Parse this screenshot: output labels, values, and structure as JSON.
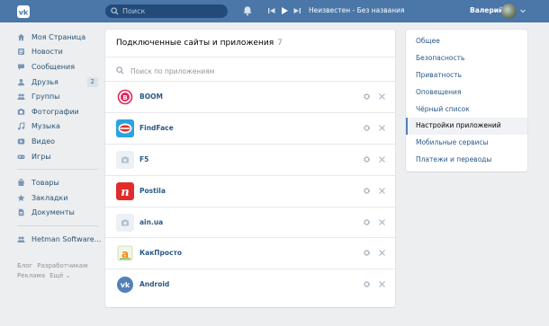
{
  "header": {
    "search_placeholder": "Поиск",
    "player_track": "Неизвестен - Без названия",
    "user_name": "Валерий",
    "brand_color": "#4a76a8"
  },
  "sidebar": {
    "items": [
      {
        "label": "Моя Страница",
        "icon": "home-icon"
      },
      {
        "label": "Новости",
        "icon": "news-icon"
      },
      {
        "label": "Сообщения",
        "icon": "messages-icon"
      },
      {
        "label": "Друзья",
        "icon": "friends-icon",
        "count": "2"
      },
      {
        "label": "Группы",
        "icon": "groups-icon"
      },
      {
        "label": "Фотографии",
        "icon": "photos-icon"
      },
      {
        "label": "Музыка",
        "icon": "music-icon"
      },
      {
        "label": "Видео",
        "icon": "video-icon"
      },
      {
        "label": "Игры",
        "icon": "games-icon"
      }
    ],
    "items2": [
      {
        "label": "Товары",
        "icon": "market-icon"
      },
      {
        "label": "Закладки",
        "icon": "bookmarks-icon"
      },
      {
        "label": "Документы",
        "icon": "documents-icon"
      }
    ],
    "items3": [
      {
        "label": "Hetman Software...",
        "icon": "community-icon"
      }
    ],
    "footer": {
      "blog": "Блог",
      "developers": "Разработчикам",
      "ads": "Реклама",
      "more": "Ещё ⌄"
    }
  },
  "main": {
    "title": "Подключенные сайты и приложения",
    "count": "7",
    "search_placeholder": "Поиск по приложениям",
    "apps": [
      {
        "name": "BOOM",
        "icon": "boom-logo"
      },
      {
        "name": "FindFace",
        "icon": "findface-logo"
      },
      {
        "name": "F5",
        "icon": "camera-placeholder-icon"
      },
      {
        "name": "Postila",
        "icon": "postila-logo"
      },
      {
        "name": "ain.ua",
        "icon": "camera-placeholder-icon"
      },
      {
        "name": "КакПросто",
        "icon": "kakprosto-logo"
      },
      {
        "name": "Android",
        "icon": "vk-android-logo"
      }
    ]
  },
  "settings_menu": {
    "items": [
      {
        "label": "Общее",
        "active": false
      },
      {
        "label": "Безопасность",
        "active": false
      },
      {
        "label": "Приватность",
        "active": false
      },
      {
        "label": "Оповещения",
        "active": false
      },
      {
        "label": "Чёрный список",
        "active": false
      },
      {
        "label": "Настройки приложений",
        "active": true
      },
      {
        "label": "Мобильные сервисы",
        "active": false
      },
      {
        "label": "Платежи и переводы",
        "active": false
      }
    ]
  }
}
